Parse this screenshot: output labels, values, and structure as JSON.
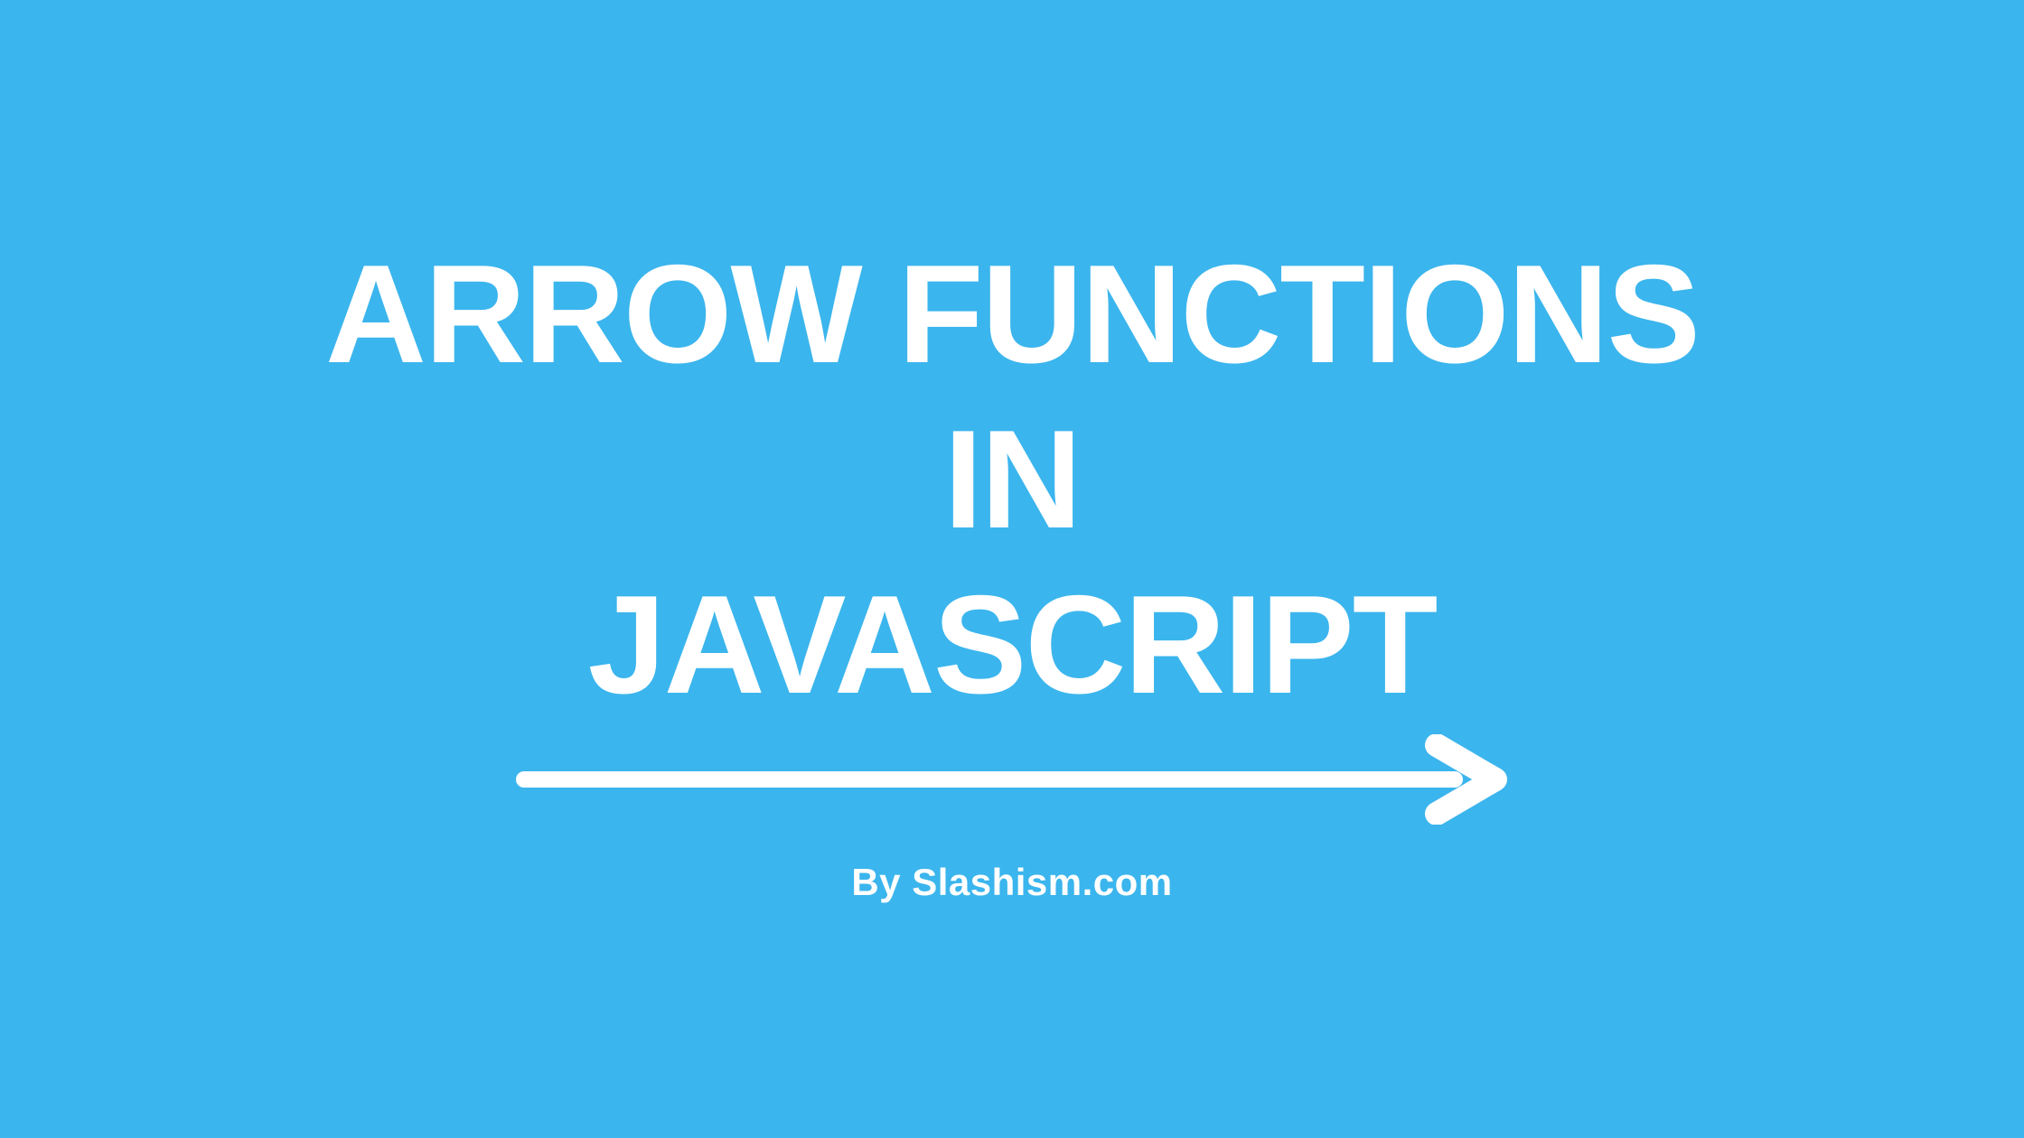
{
  "title": {
    "line1": "Arrow Functions",
    "line2": "In",
    "line3": "JavaScript"
  },
  "byline": "By Slashism.com",
  "colors": {
    "background": "#3BB5ED",
    "text": "#FFFFFF"
  }
}
